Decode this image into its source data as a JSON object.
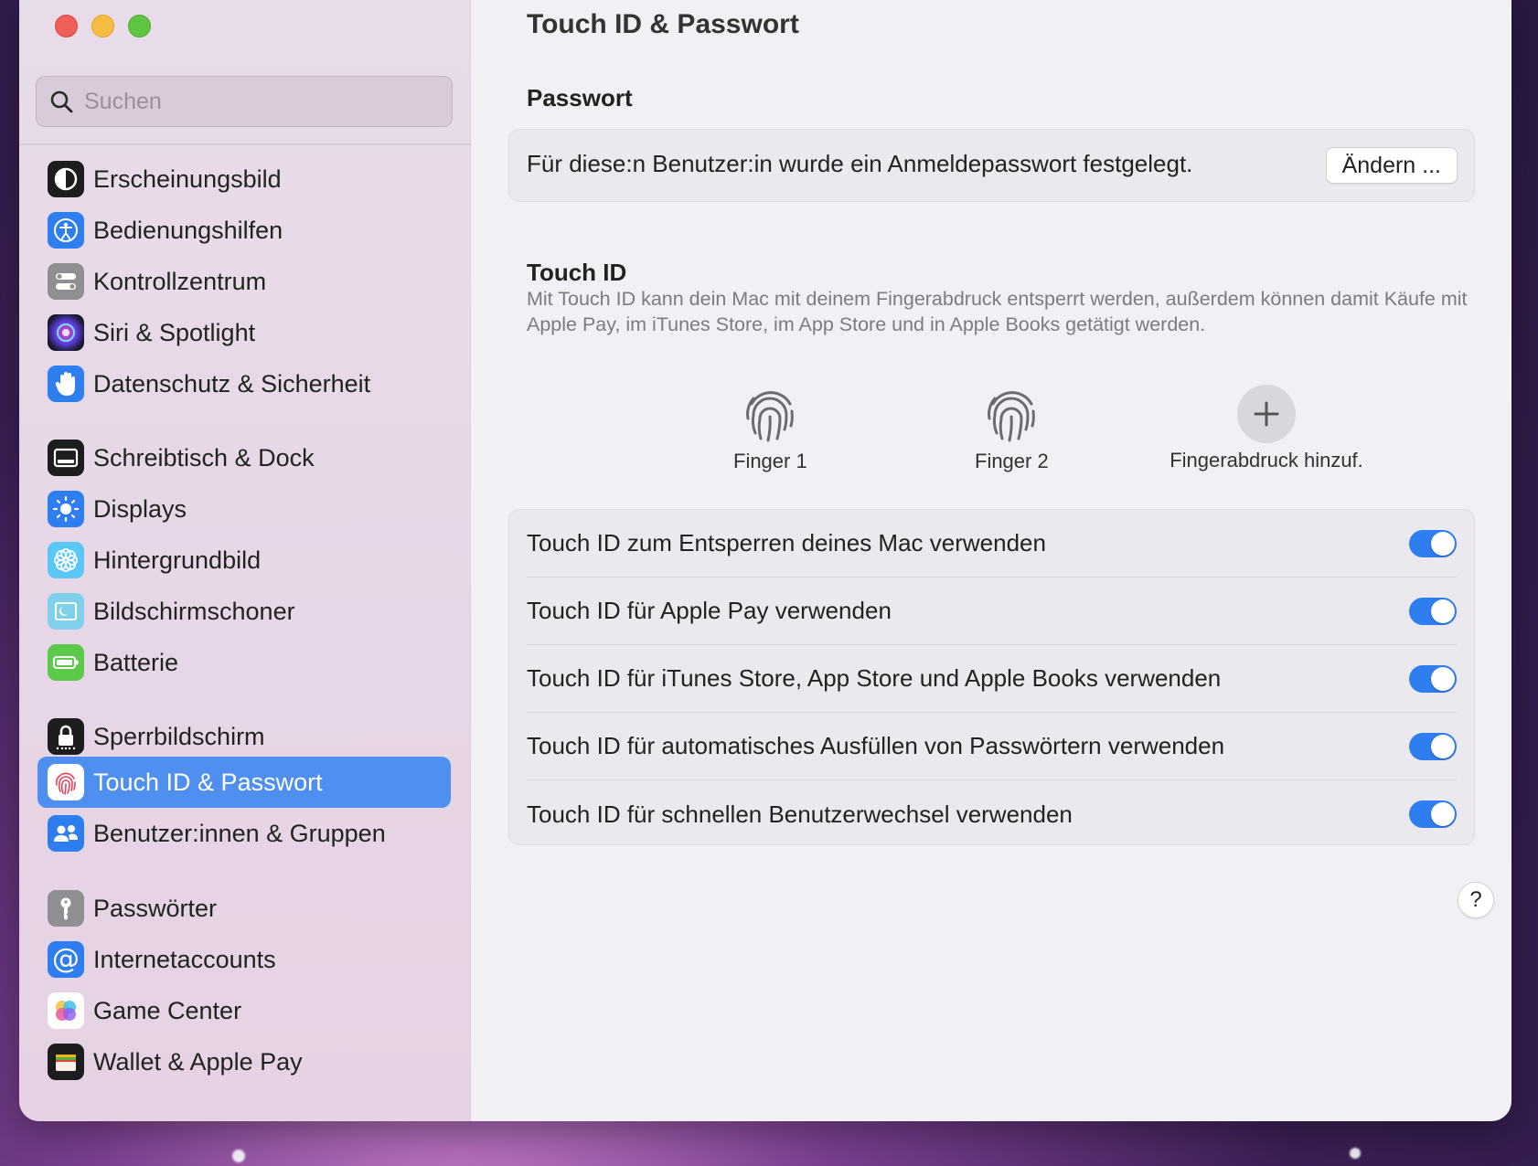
{
  "window": {
    "title": "Touch ID & Passwort"
  },
  "sidebar": {
    "search_placeholder": "Suchen",
    "items": [
      {
        "label": "Erscheinungsbild",
        "icon": "appearance-icon"
      },
      {
        "label": "Bedienungshilfen",
        "icon": "accessibility-icon"
      },
      {
        "label": "Kontrollzentrum",
        "icon": "control-center-icon"
      },
      {
        "label": "Siri & Spotlight",
        "icon": "siri-icon"
      },
      {
        "label": "Datenschutz & Sicherheit",
        "icon": "hand-icon"
      },
      {
        "label": "Schreibtisch & Dock",
        "icon": "dock-icon"
      },
      {
        "label": "Displays",
        "icon": "sun-icon"
      },
      {
        "label": "Hintergrundbild",
        "icon": "flower-icon"
      },
      {
        "label": "Bildschirmschoner",
        "icon": "screensaver-icon"
      },
      {
        "label": "Batterie",
        "icon": "battery-icon"
      },
      {
        "label": "Sperrbildschirm",
        "icon": "lock-icon"
      },
      {
        "label": "Touch ID & Passwort",
        "icon": "fingerprint-icon",
        "active": true
      },
      {
        "label": "Benutzer:innen & Gruppen",
        "icon": "users-icon"
      },
      {
        "label": "Passwörter",
        "icon": "key-icon"
      },
      {
        "label": "Internetaccounts",
        "icon": "at-icon"
      },
      {
        "label": "Game Center",
        "icon": "game-center-icon"
      },
      {
        "label": "Wallet & Apple Pay",
        "icon": "wallet-icon"
      }
    ]
  },
  "main": {
    "password_section": {
      "heading": "Passwort",
      "text": "Für diese:n Benutzer:in wurde ein Anmeldepasswort festgelegt.",
      "button_label": "Ändern ..."
    },
    "touchid_section": {
      "heading": "Touch ID",
      "description": "Mit Touch ID kann dein Mac mit deinem Fingerabdruck entsperrt werden, außerdem können damit Käufe mit Apple Pay, im iTunes Store, im App Store und in Apple Books getätigt werden.",
      "fingerprints": [
        {
          "label": "Finger 1"
        },
        {
          "label": "Finger 2"
        }
      ],
      "add_label": "Fingerabdruck hinzuf."
    },
    "toggles": [
      {
        "label": "Touch ID zum Entsperren deines Mac verwenden",
        "on": true
      },
      {
        "label": "Touch ID für Apple Pay verwenden",
        "on": true
      },
      {
        "label": "Touch ID für iTunes Store, App Store und Apple Books verwenden",
        "on": true
      },
      {
        "label": "Touch ID für automatisches Ausfüllen von Passwörtern verwenden",
        "on": true
      },
      {
        "label": "Touch ID für schnellen Benutzerwechsel verwenden",
        "on": true
      }
    ],
    "help_label": "?"
  },
  "colors": {
    "accent": "#2f7ef0",
    "sidebar_active": "#4f8ff0"
  }
}
